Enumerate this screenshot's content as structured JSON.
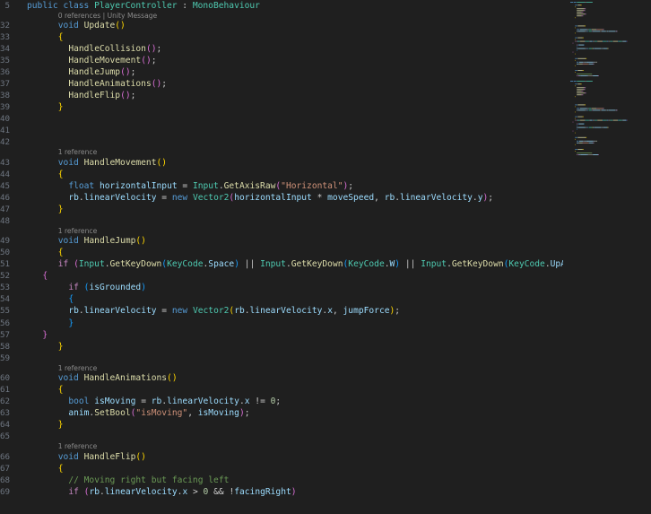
{
  "editor": {
    "lines": [
      {
        "num": "5",
        "tokens": [
          [
            "public",
            "kw"
          ],
          [
            " ",
            "pl"
          ],
          [
            "class",
            "kw"
          ],
          [
            " ",
            "pl"
          ],
          [
            "PlayerController",
            "type"
          ],
          [
            " : ",
            "pl"
          ],
          [
            "MonoBehaviour",
            "type"
          ]
        ]
      },
      {
        "lens": "0 references | Unity Message",
        "indent": 6
      },
      {
        "num": "32",
        "indent": 6,
        "tokens": [
          [
            "void",
            "kw"
          ],
          [
            " ",
            "pl"
          ],
          [
            "Update",
            "fn"
          ],
          [
            "()",
            "p1"
          ]
        ]
      },
      {
        "num": "33",
        "indent": 6,
        "tokens": [
          [
            "{",
            "p1"
          ]
        ]
      },
      {
        "num": "34",
        "indent": 8,
        "tokens": [
          [
            "HandleCollision",
            "fn"
          ],
          [
            "()",
            "p2"
          ],
          [
            ";",
            "pl"
          ]
        ]
      },
      {
        "num": "35",
        "indent": 8,
        "tokens": [
          [
            "HandleMovement",
            "fn"
          ],
          [
            "()",
            "p2"
          ],
          [
            ";",
            "pl"
          ]
        ]
      },
      {
        "num": "36",
        "indent": 8,
        "tokens": [
          [
            "HandleJump",
            "fn"
          ],
          [
            "()",
            "p2"
          ],
          [
            ";",
            "pl"
          ]
        ]
      },
      {
        "num": "37",
        "indent": 8,
        "tokens": [
          [
            "HandleAnimations",
            "fn"
          ],
          [
            "()",
            "p2"
          ],
          [
            ";",
            "pl"
          ]
        ]
      },
      {
        "num": "38",
        "indent": 8,
        "tokens": [
          [
            "HandleFlip",
            "fn"
          ],
          [
            "()",
            "p2"
          ],
          [
            ";",
            "pl"
          ]
        ]
      },
      {
        "num": "39",
        "indent": 6,
        "tokens": [
          [
            "}",
            "p1"
          ]
        ]
      },
      {
        "num": "40",
        "tokens": []
      },
      {
        "num": "41",
        "tokens": []
      },
      {
        "num": "42",
        "tokens": []
      },
      {
        "lens": "1 reference",
        "indent": 6
      },
      {
        "num": "43",
        "indent": 6,
        "tokens": [
          [
            "void",
            "kw"
          ],
          [
            " ",
            "pl"
          ],
          [
            "HandleMovement",
            "fn"
          ],
          [
            "()",
            "p1"
          ]
        ]
      },
      {
        "num": "44",
        "indent": 6,
        "tokens": [
          [
            "{",
            "p1"
          ]
        ]
      },
      {
        "num": "45",
        "indent": 8,
        "tokens": [
          [
            "float",
            "kw"
          ],
          [
            " ",
            "pl"
          ],
          [
            "horizontalInput",
            "var"
          ],
          [
            " = ",
            "pl"
          ],
          [
            "Input",
            "type"
          ],
          [
            ".",
            "pl"
          ],
          [
            "GetAxisRaw",
            "fn"
          ],
          [
            "(",
            "p2"
          ],
          [
            "\"Horizontal\"",
            "str"
          ],
          [
            ")",
            "p2"
          ],
          [
            ";",
            "pl"
          ]
        ]
      },
      {
        "num": "46",
        "indent": 8,
        "tokens": [
          [
            "rb",
            "var"
          ],
          [
            ".",
            "pl"
          ],
          [
            "linearVelocity",
            "var"
          ],
          [
            " = ",
            "pl"
          ],
          [
            "new",
            "kw"
          ],
          [
            " ",
            "pl"
          ],
          [
            "Vector2",
            "type"
          ],
          [
            "(",
            "p2"
          ],
          [
            "horizontalInput",
            "var"
          ],
          [
            " * ",
            "pl"
          ],
          [
            "moveSpeed",
            "var"
          ],
          [
            ", ",
            "pl"
          ],
          [
            "rb",
            "var"
          ],
          [
            ".",
            "pl"
          ],
          [
            "linearVelocity",
            "var"
          ],
          [
            ".",
            "pl"
          ],
          [
            "y",
            "var"
          ],
          [
            ")",
            "p2"
          ],
          [
            ";",
            "pl"
          ]
        ]
      },
      {
        "num": "47",
        "indent": 6,
        "tokens": [
          [
            "}",
            "p1"
          ]
        ]
      },
      {
        "num": "48",
        "tokens": []
      },
      {
        "lens": "1 reference",
        "indent": 6
      },
      {
        "num": "49",
        "indent": 6,
        "tokens": [
          [
            "void",
            "kw"
          ],
          [
            " ",
            "pl"
          ],
          [
            "HandleJump",
            "fn"
          ],
          [
            "()",
            "p1"
          ]
        ]
      },
      {
        "num": "50",
        "indent": 6,
        "tokens": [
          [
            "{",
            "p1"
          ]
        ]
      },
      {
        "num": "51",
        "indent": 6,
        "tokens": [
          [
            "if",
            "ctrl"
          ],
          [
            " ",
            "pl"
          ],
          [
            "(",
            "p2"
          ],
          [
            "Input",
            "type"
          ],
          [
            ".",
            "pl"
          ],
          [
            "GetKeyDown",
            "fn"
          ],
          [
            "(",
            "p3"
          ],
          [
            "KeyCode",
            "type"
          ],
          [
            ".",
            "pl"
          ],
          [
            "Space",
            "var"
          ],
          [
            ")",
            "p3"
          ],
          [
            " || ",
            "pl"
          ],
          [
            "Input",
            "type"
          ],
          [
            ".",
            "pl"
          ],
          [
            "GetKeyDown",
            "fn"
          ],
          [
            "(",
            "p3"
          ],
          [
            "KeyCode",
            "type"
          ],
          [
            ".",
            "pl"
          ],
          [
            "W",
            "var"
          ],
          [
            ")",
            "p3"
          ],
          [
            " || ",
            "pl"
          ],
          [
            "Input",
            "type"
          ],
          [
            ".",
            "pl"
          ],
          [
            "GetKeyDown",
            "fn"
          ],
          [
            "(",
            "p3"
          ],
          [
            "KeyCode",
            "type"
          ],
          [
            ".",
            "pl"
          ],
          [
            "UpArrow",
            "var"
          ],
          [
            ")",
            "p3"
          ],
          [
            ")",
            "p2"
          ]
        ]
      },
      {
        "num": "52",
        "indent": 3,
        "tokens": [
          [
            "{",
            "p2"
          ]
        ]
      },
      {
        "num": "53",
        "indent": 8,
        "tokens": [
          [
            "if",
            "ctrl"
          ],
          [
            " ",
            "pl"
          ],
          [
            "(",
            "p3"
          ],
          [
            "isGrounded",
            "var"
          ],
          [
            ")",
            "p3"
          ]
        ]
      },
      {
        "num": "54",
        "indent": 8,
        "tokens": [
          [
            "{",
            "p3"
          ]
        ]
      },
      {
        "num": "55",
        "indent": 8,
        "tokens": [
          [
            "rb",
            "var"
          ],
          [
            ".",
            "pl"
          ],
          [
            "linearVelocity",
            "var"
          ],
          [
            " = ",
            "pl"
          ],
          [
            "new",
            "kw"
          ],
          [
            " ",
            "pl"
          ],
          [
            "Vector2",
            "type"
          ],
          [
            "(",
            "p1"
          ],
          [
            "rb",
            "var"
          ],
          [
            ".",
            "pl"
          ],
          [
            "linearVelocity",
            "var"
          ],
          [
            ".",
            "pl"
          ],
          [
            "x",
            "var"
          ],
          [
            ", ",
            "pl"
          ],
          [
            "jumpForce",
            "var"
          ],
          [
            ")",
            "p1"
          ],
          [
            ";",
            "pl"
          ]
        ]
      },
      {
        "num": "56",
        "indent": 8,
        "tokens": [
          [
            "}",
            "p3"
          ]
        ]
      },
      {
        "num": "57",
        "indent": 3,
        "tokens": [
          [
            "}",
            "p2"
          ]
        ]
      },
      {
        "num": "58",
        "indent": 6,
        "tokens": [
          [
            "}",
            "p1"
          ]
        ]
      },
      {
        "num": "59",
        "tokens": []
      },
      {
        "lens": "1 reference",
        "indent": 6
      },
      {
        "num": "60",
        "indent": 6,
        "tokens": [
          [
            "void",
            "kw"
          ],
          [
            " ",
            "pl"
          ],
          [
            "HandleAnimations",
            "fn"
          ],
          [
            "()",
            "p1"
          ]
        ]
      },
      {
        "num": "61",
        "indent": 6,
        "tokens": [
          [
            "{",
            "p1"
          ]
        ]
      },
      {
        "num": "62",
        "indent": 8,
        "tokens": [
          [
            "bool",
            "kw"
          ],
          [
            " ",
            "pl"
          ],
          [
            "isMoving",
            "var"
          ],
          [
            " = ",
            "pl"
          ],
          [
            "rb",
            "var"
          ],
          [
            ".",
            "pl"
          ],
          [
            "linearVelocity",
            "var"
          ],
          [
            ".",
            "pl"
          ],
          [
            "x",
            "var"
          ],
          [
            " != ",
            "pl"
          ],
          [
            "0",
            "num"
          ],
          [
            ";",
            "pl"
          ]
        ]
      },
      {
        "num": "63",
        "indent": 8,
        "tokens": [
          [
            "anim",
            "var"
          ],
          [
            ".",
            "pl"
          ],
          [
            "SetBool",
            "fn"
          ],
          [
            "(",
            "p2"
          ],
          [
            "\"isMoving\"",
            "str"
          ],
          [
            ", ",
            "pl"
          ],
          [
            "isMoving",
            "var"
          ],
          [
            ")",
            "p2"
          ],
          [
            ";",
            "pl"
          ]
        ]
      },
      {
        "num": "64",
        "indent": 6,
        "tokens": [
          [
            "}",
            "p1"
          ]
        ]
      },
      {
        "num": "65",
        "tokens": []
      },
      {
        "lens": "1 reference",
        "indent": 6
      },
      {
        "num": "66",
        "indent": 6,
        "tokens": [
          [
            "void",
            "kw"
          ],
          [
            " ",
            "pl"
          ],
          [
            "HandleFlip",
            "fn"
          ],
          [
            "()",
            "p1"
          ]
        ]
      },
      {
        "num": "67",
        "indent": 6,
        "tokens": [
          [
            "{",
            "p1"
          ]
        ]
      },
      {
        "num": "68",
        "indent": 8,
        "tokens": [
          [
            "// Moving right but facing left",
            "com"
          ]
        ]
      },
      {
        "num": "69",
        "indent": 8,
        "tokens": [
          [
            "if",
            "ctrl"
          ],
          [
            " ",
            "pl"
          ],
          [
            "(",
            "p2"
          ],
          [
            "rb",
            "var"
          ],
          [
            ".",
            "pl"
          ],
          [
            "linearVelocity",
            "var"
          ],
          [
            ".",
            "pl"
          ],
          [
            "x",
            "var"
          ],
          [
            " > ",
            "pl"
          ],
          [
            "0",
            "num"
          ],
          [
            " && ",
            "pl"
          ],
          [
            "!",
            "pl"
          ],
          [
            "facingRight",
            "var"
          ],
          [
            ")",
            "p2"
          ]
        ]
      }
    ]
  },
  "colors": {
    "background": "#1f1f1f",
    "line_number": "#6e7681",
    "keyword": "#569cd6",
    "control": "#c586c0",
    "type": "#4ec9b0",
    "function": "#dcdcaa",
    "variable": "#9cdcfe",
    "string": "#ce9178",
    "number": "#b5cea8",
    "comment": "#6a9955"
  }
}
